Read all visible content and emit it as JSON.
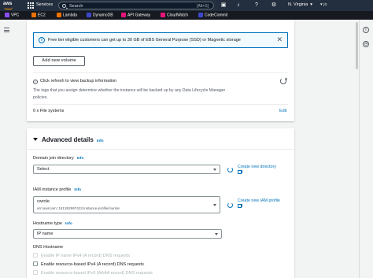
{
  "topnav": {
    "logo": "aws",
    "services": "Services",
    "search_placeholder": "Search",
    "search_shortcut": "[Alt+S]",
    "region": "N. Virginia",
    "account": "▾ jo"
  },
  "favorites": [
    {
      "label": "VPC",
      "color": "#8c4fff"
    },
    {
      "label": "EC2",
      "color": "#ed7100"
    },
    {
      "label": "Lambda",
      "color": "#ed7100"
    },
    {
      "label": "DynamoDB",
      "color": "#3b48cc"
    },
    {
      "label": "API Gateway",
      "color": "#e7157b"
    },
    {
      "label": "CloudWatch",
      "color": "#e7157b"
    },
    {
      "label": "CodeCommit",
      "color": "#3b48cc"
    }
  ],
  "storage": {
    "alert_text": "Free tier eligible customers can get up to 30 GB of EBS General Purpose (SSD) or Magnetic storage",
    "add_volume": "Add new volume",
    "backup_title": "Click refresh to view backup information",
    "backup_desc": "The tags that you assign determine whether the instance will be backed up by any Data Lifecycle Manager policies.",
    "file_systems": "0 x File systems",
    "edit": "Edit"
  },
  "advanced": {
    "title": "Advanced details",
    "info": "Info",
    "domain_label": "Domain join directory",
    "domain_info": "Info",
    "domain_value": "Select",
    "create_directory": "Create new directory",
    "iam_label": "IAM instance profile",
    "iam_info": "Info",
    "iam_value": "cwrole",
    "iam_arn": "arn:aws:iam::181382997422:instance-profile/cwrole",
    "create_iam": "Create new IAM profile",
    "hostname_label": "Hostname type",
    "hostname_info": "Info",
    "hostname_value": "IP name",
    "dns_label": "DNS Hostname",
    "dns_opt1": "Enable IP name IPv4 (A record) DNS requests",
    "dns_opt2": "Enable resource-based IPv4 (A record) DNS requests",
    "dns_opt3": "Enable resource-based IPv6 (AAAA record) DNS requests"
  }
}
